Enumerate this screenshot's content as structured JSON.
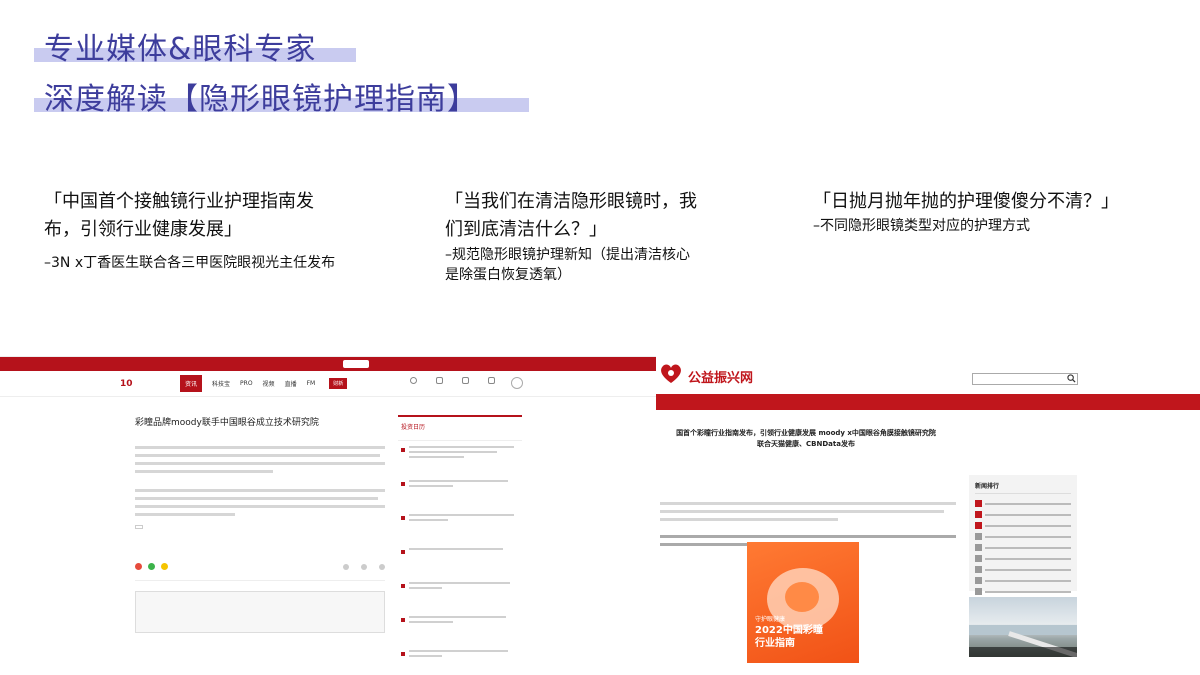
{
  "slide": {
    "title_line1": "专业媒体&眼科专家",
    "title_line2": "深度解读【隐形眼镜护理指南】",
    "accent_color": "#3d3d9c",
    "highlight_color": "#c9cbf0"
  },
  "points": [
    {
      "quote_line1": "「中国首个接触镜行业护理指南发",
      "quote_line2": "布，引领行业健康发展」",
      "sub_line1": "–3N x丁香医生联合各三甲医院眼视光主任发布",
      "sub_line2": ""
    },
    {
      "quote_line1": "「当我们在清洁隐形眼镜时，我",
      "quote_line2": "们到底清洁什么？」",
      "sub_line1": "–规范隐形眼镜护理新知（提出清洁核心",
      "sub_line2": "是除蛋白恢复透氧）"
    },
    {
      "quote_line1": "「日抛月抛年抛的护理傻傻分不清？」",
      "quote_line2": "",
      "sub_line1": "–不同隐形眼镜类型对应的护理方式",
      "sub_line2": ""
    }
  ],
  "left_site": {
    "brand_color": "#b5121b",
    "logo": "10",
    "nav": [
      "资讯",
      "科技宝",
      "PRO",
      "视频",
      "直播",
      "FM"
    ],
    "nav_button": "财新",
    "article_title": "彩瞳品牌moody联手中国眼谷成立技术研究院",
    "sidebar_title": "投资日历"
  },
  "right_site": {
    "brand_color": "#c0161c",
    "logo_text": "公益振兴网",
    "headline_line1": "国首个彩瞳行业指南发布，引领行业健康发展 moody x中国眼谷角膜接触镜研究院",
    "headline_line2": "联合天猫健康、CBNData发布",
    "report_subtitle": "守护眼健康",
    "report_title_line1": "2022中国彩瞳",
    "report_title_line2": "行业指南",
    "rank_title": "新闻排行"
  }
}
